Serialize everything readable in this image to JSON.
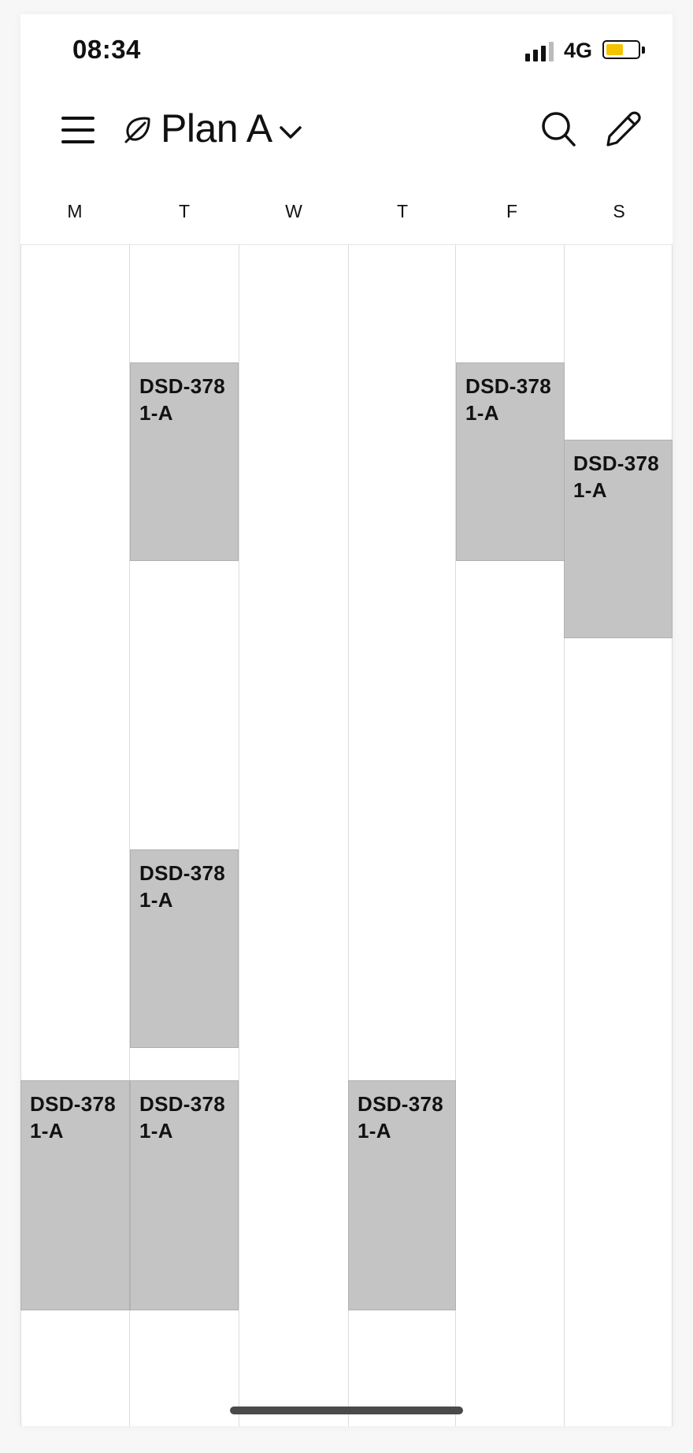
{
  "status_bar": {
    "time": "08:34",
    "network": "4G",
    "battery_level": 0.55,
    "battery_color": "#f5c400"
  },
  "app_bar": {
    "menu_icon": "hamburger-menu-icon",
    "leaf_icon": "leaf-icon",
    "plan_title": "Plan A",
    "dropdown_icon": "chevron-down-icon",
    "search_icon": "search-icon",
    "edit_icon": "pencil-icon"
  },
  "week": {
    "days": [
      "M",
      "T",
      "W",
      "T",
      "F",
      "S"
    ]
  },
  "events": [
    {
      "day": "T",
      "label": "DSD-3781-A"
    },
    {
      "day": "F",
      "label": "DSD-3781-A"
    },
    {
      "day": "S",
      "label": "DSD-3781-A"
    },
    {
      "day": "T",
      "label": "DSD-3781-A"
    },
    {
      "day": "M",
      "label": "DSD-3781-A"
    },
    {
      "day": "T",
      "label": "DSD-3781-A"
    },
    {
      "day": "T",
      "label": "DSD-3781-A"
    }
  ],
  "colors": {
    "event_fill": "#c4c4c4",
    "grid_line": "#dddddd",
    "background": "#ffffff"
  }
}
